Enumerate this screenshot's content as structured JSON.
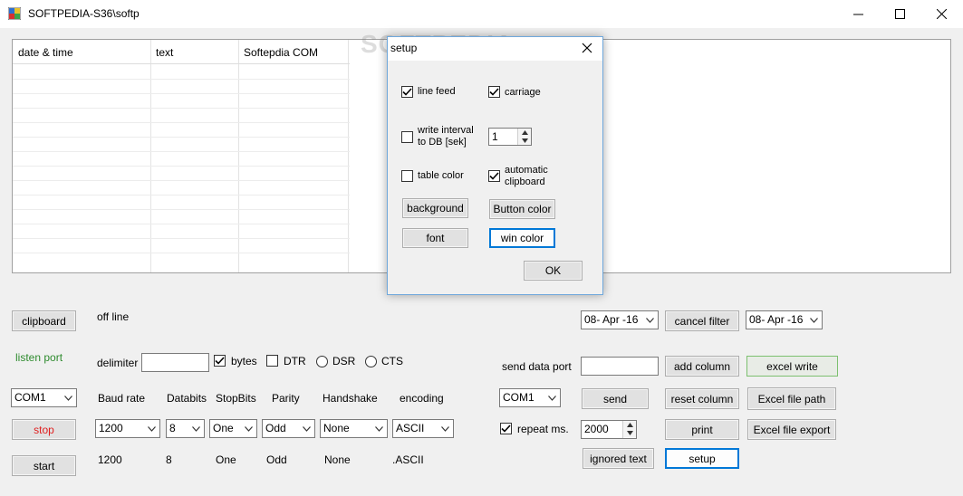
{
  "window": {
    "title": "SOFTPEDIA-S36\\softp"
  },
  "watermark": "SOFTPEDIA",
  "grid": {
    "columns": [
      "date & time",
      "text",
      "Softepdia COM"
    ]
  },
  "status": {
    "connection": "off line",
    "listen": "listen port"
  },
  "buttons": {
    "clipboard": "clipboard",
    "stop": "stop",
    "start": "start",
    "cancel_filter": "cancel filter",
    "add_column": "add column",
    "excel_write": "excel write",
    "send": "send",
    "reset_column": "reset column",
    "excel_file_path": "Excel file path",
    "print": "print",
    "excel_file_export": "Excel file export",
    "ignored_text": "ignored text",
    "setup": "setup"
  },
  "serial": {
    "delimiter_label": "delimiter",
    "bytes_label": "bytes",
    "dtr_label": "DTR",
    "dsr_label": "DSR",
    "cts_label": "CTS",
    "headers": [
      "Baud rate",
      "Databits",
      "StopBits",
      "Parity",
      "Handshake",
      "encoding"
    ],
    "port": "COM1",
    "baud": "1200",
    "databits": "8",
    "stopbits": "One",
    "parity": "Odd",
    "handshake": "None",
    "encoding": "ASCII",
    "values": [
      "1200",
      "8",
      "One",
      "Odd",
      "None",
      ".ASCII"
    ]
  },
  "send": {
    "label": "send data port",
    "port": "COM1",
    "repeat_label": "repeat ms.",
    "repeat_value": "2000"
  },
  "filter": {
    "date_from": "08- Apr -16",
    "date_to": "08- Apr -16"
  },
  "dialog": {
    "title": "setup",
    "line_feed": "line feed",
    "carriage": "carriage",
    "write_interval_1": "write  interval",
    "write_interval_2": "to DB [sek]",
    "interval_value": "1",
    "table_color": "table color",
    "auto_clip_1": "automatic",
    "auto_clip_2": "clipboard",
    "background": "background",
    "button_color": "Button color",
    "font": "font",
    "win_color": "win color",
    "ok": "OK"
  },
  "colors": {
    "accent": "#0078d7",
    "status_green": "#2e8b2e",
    "stop_red": "#e02020",
    "excel_border": "#7cc06f"
  }
}
